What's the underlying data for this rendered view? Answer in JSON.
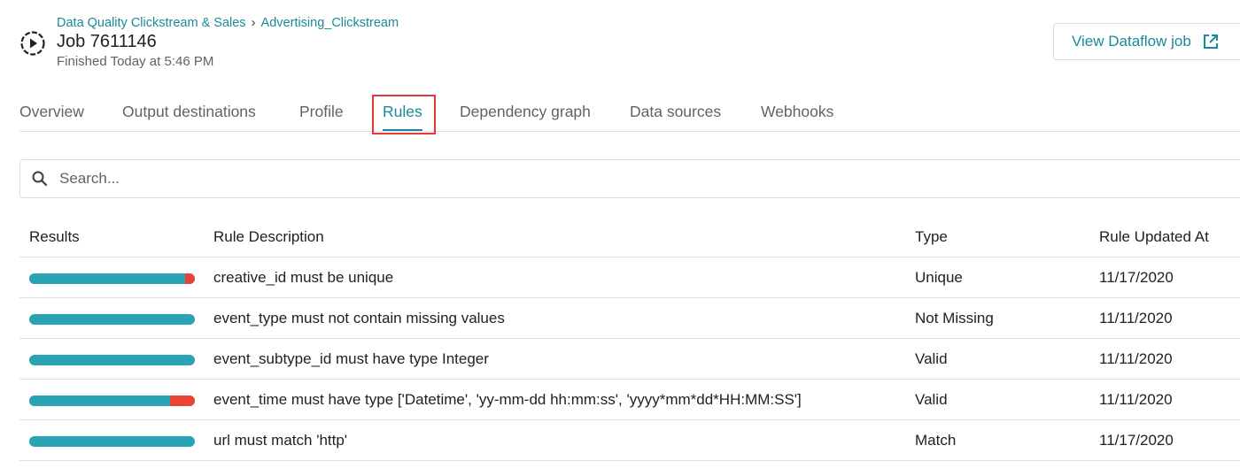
{
  "header": {
    "breadcrumb": [
      {
        "label": "Data Quality Clickstream & Sales"
      },
      {
        "label": "Advertising_Clickstream"
      }
    ],
    "breadcrumb_separator": "›",
    "job_title": "Job 7611146",
    "job_status": "Finished Today at 5:46 PM",
    "view_dataflow_label": "View Dataflow job"
  },
  "tabs": [
    {
      "label": "Overview",
      "active": false
    },
    {
      "label": "Output destinations",
      "active": false
    },
    {
      "label": "Profile",
      "active": false
    },
    {
      "label": "Rules",
      "active": true
    },
    {
      "label": "Dependency graph",
      "active": false
    },
    {
      "label": "Data sources",
      "active": false
    },
    {
      "label": "Webhooks",
      "active": false
    }
  ],
  "search": {
    "placeholder": "Search...",
    "value": ""
  },
  "table": {
    "columns": [
      "Results",
      "Rule Description",
      "Type",
      "Rule Updated At"
    ],
    "rows": [
      {
        "pass_fraction": 0.94,
        "description": "creative_id must be unique",
        "type": "Unique",
        "updated": "11/17/2020"
      },
      {
        "pass_fraction": 1.0,
        "description": "event_type must not contain missing values",
        "type": "Not Missing",
        "updated": "11/11/2020"
      },
      {
        "pass_fraction": 1.0,
        "description": "event_subtype_id must have type Integer",
        "type": "Valid",
        "updated": "11/11/2020"
      },
      {
        "pass_fraction": 0.85,
        "description": "event_time must have type ['Datetime', 'yy-mm-dd hh:mm:ss', 'yyyy*mm*dd*HH:MM:SS']",
        "type": "Valid",
        "updated": "11/11/2020"
      },
      {
        "pass_fraction": 1.0,
        "description": "url must match 'http'",
        "type": "Match",
        "updated": "11/17/2020"
      }
    ]
  },
  "colors": {
    "accent": "#1a8a9a",
    "bar_pass": "#2aa3b5",
    "bar_fail": "#ea4335",
    "highlight": "#e53935"
  }
}
